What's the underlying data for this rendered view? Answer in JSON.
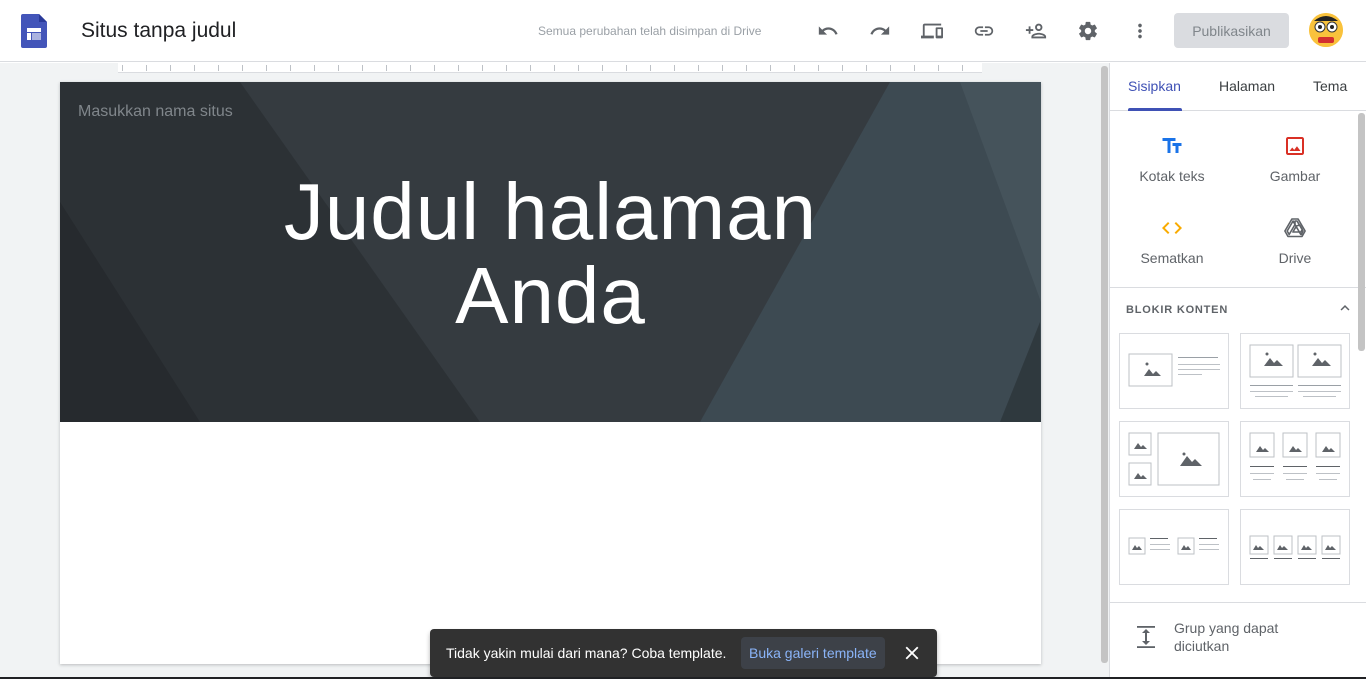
{
  "header": {
    "title": "Situs tanpa judul",
    "save_status": "Semua perubahan telah disimpan di Drive",
    "publish_label": "Publikasikan"
  },
  "hero": {
    "site_name_placeholder": "Masukkan nama situs",
    "title_line1": "Judul halaman",
    "title_line2": "Anda"
  },
  "panel": {
    "tabs": [
      {
        "label": "Sisipkan",
        "active": true
      },
      {
        "label": "Halaman",
        "active": false
      },
      {
        "label": "Tema",
        "active": false
      }
    ],
    "insert_items": [
      {
        "label": "Kotak teks",
        "icon": "text-box-icon"
      },
      {
        "label": "Gambar",
        "icon": "image-icon"
      },
      {
        "label": "Sematkan",
        "icon": "embed-icon"
      },
      {
        "label": "Drive",
        "icon": "drive-icon"
      }
    ],
    "content_blocks_heading": "BLOKIR KONTEN",
    "collapsible_group_label": "Grup yang dapat diciutkan"
  },
  "snackbar": {
    "message": "Tidak yakin mulai dari mana? Coba template.",
    "action_label": "Buka galeri template"
  },
  "colors": {
    "accent": "#3f51b5",
    "hero_bg": "#353b40",
    "image_icon": "#d93025",
    "embed_icon": "#f9ab00",
    "text_icon": "#1a73e8"
  }
}
